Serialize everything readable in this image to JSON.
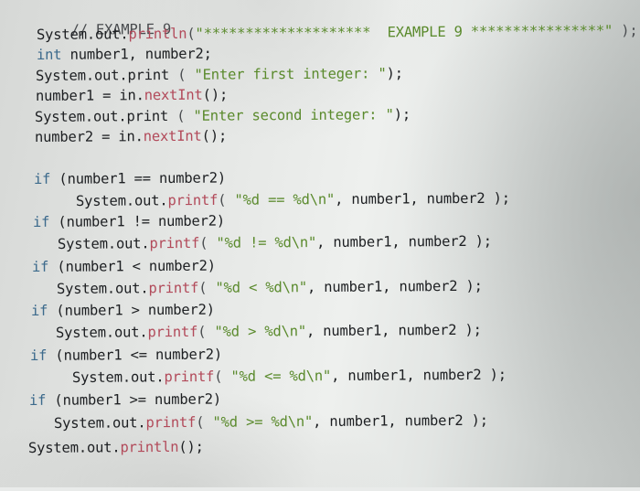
{
  "editor": {
    "lines": [
      {
        "comment": "// EXAMPLE 9"
      },
      {
        "obj": "System.out.",
        "method": "println",
        "open": "(",
        "string": "\"********************  EXAMPLE 9 ****************\"",
        "close": " );"
      },
      {
        "keyword": "int",
        "rest": " number1, number2;"
      },
      {
        "obj": "System.out.print",
        "open": " ( ",
        "string": "\"Enter first integer: \"",
        "close": ");"
      },
      {
        "lhs": "number1 = in.",
        "method": "nextInt",
        "close": "();"
      },
      {
        "obj": "System.out.print",
        "open": " ( ",
        "string": "\"Enter second integer: \"",
        "close": ");"
      },
      {
        "lhs": "number2 = in.",
        "method": "nextInt",
        "close": "();"
      },
      {
        "keyword": "if",
        "cond": " (number1 == number2)"
      },
      {
        "obj": "System.out.",
        "method": "printf",
        "open": "( ",
        "string": "\"%d == %d\\n\"",
        "close": ", number1, number2 );"
      },
      {
        "keyword": "if",
        "cond": " (number1 != number2)"
      },
      {
        "obj": "System.out.",
        "method": "printf",
        "open": "( ",
        "string": "\"%d != %d\\n\"",
        "close": ", number1, number2 );"
      },
      {
        "keyword": "if",
        "cond": " (number1 < number2)"
      },
      {
        "obj": "System.out.",
        "method": "printf",
        "open": "( ",
        "string": "\"%d < %d\\n\"",
        "close": ", number1, number2 );"
      },
      {
        "keyword": "if",
        "cond": " (number1 > number2)"
      },
      {
        "obj": "System.out.",
        "method": "printf",
        "open": "( ",
        "string": "\"%d > %d\\n\"",
        "close": ", number1, number2 );"
      },
      {
        "keyword": "if",
        "cond": " (number1 <= number2)"
      },
      {
        "obj": "System.out.",
        "method": "printf",
        "open": "( ",
        "string": "\"%d <= %d\\n\"",
        "close": ", number1, number2 );"
      },
      {
        "keyword": "if",
        "cond": " (number1 >= number2)"
      },
      {
        "obj": "System.out.",
        "method": "printf",
        "open": "( ",
        "string": "\"%d >= %d\\n\"",
        "close": ", number1, number2 );"
      },
      {
        "obj": "System.out.",
        "method": "println",
        "close": "();"
      }
    ]
  },
  "colors": {
    "keyword": "#3c6a8c",
    "method": "#b24a5a",
    "string": "#5a8a2c",
    "text": "#1d1f22"
  }
}
